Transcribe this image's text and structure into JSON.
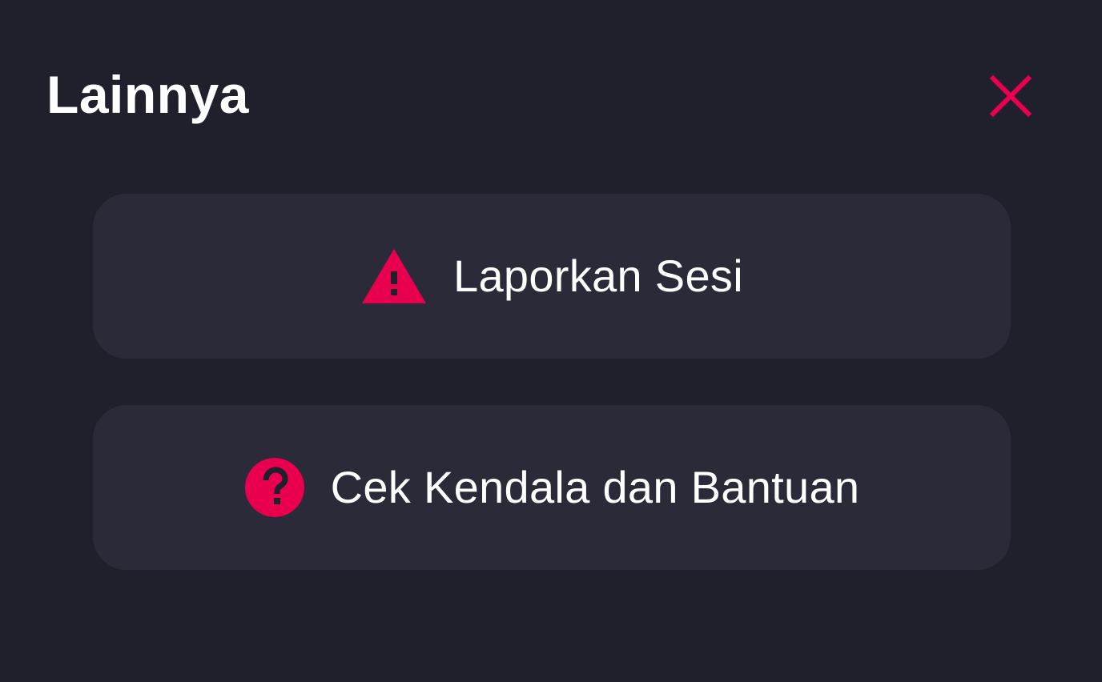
{
  "dialog": {
    "title": "Lainnya",
    "close_icon": "close-icon"
  },
  "options": [
    {
      "label": "Laporkan Sesi",
      "icon": "warning-icon"
    },
    {
      "label": "Cek Kendala dan Bantuan",
      "icon": "help-icon"
    }
  ],
  "colors": {
    "background": "#201f2c",
    "card": "#2b2a38",
    "accent": "#e8004f",
    "text": "#ffffff"
  }
}
